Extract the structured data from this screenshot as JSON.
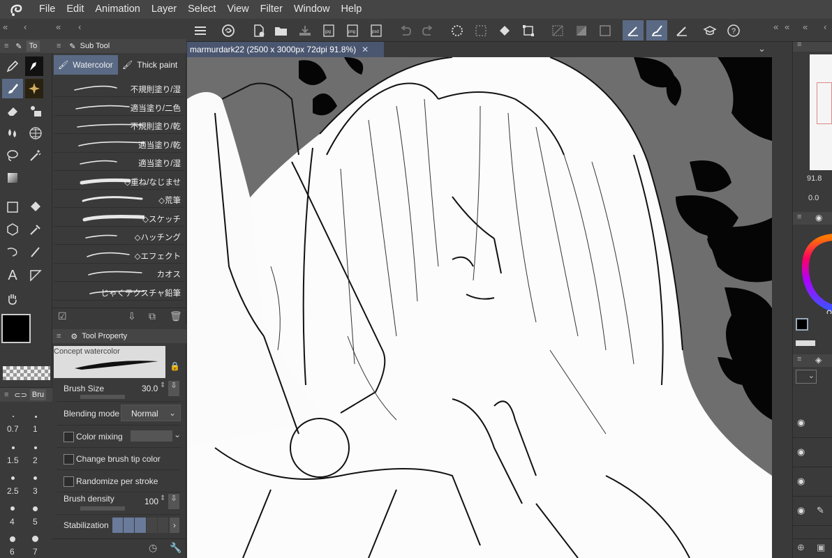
{
  "menu": [
    "File",
    "Edit",
    "Animation",
    "Layer",
    "Select",
    "View",
    "Filter",
    "Window",
    "Help"
  ],
  "left_panel": {
    "tool_tab_label": "To",
    "subtool_header": "Sub Tool",
    "subtool_tabs": [
      "Watercolor",
      "Thick paint"
    ],
    "brushes": [
      "不規則塗り/湿",
      "適当塗り/二色",
      "不規則塗り/乾",
      "適当塗り/乾",
      "適当塗り/湿",
      "◇重ね/なじませ",
      "◇荒筆",
      "◇スケッチ",
      "◇ハッチング",
      "◇エフェクト",
      "カオス",
      "じゃくテクスチャ鉛筆"
    ],
    "brush_size_tab": "Bru",
    "brush_size_values": [
      "0.7",
      "1",
      "1.5",
      "2",
      "2.5",
      "3",
      "4",
      "5",
      "6",
      "7"
    ]
  },
  "tool_property": {
    "header": "Tool Property",
    "preset_name": "Concept watercolor",
    "brush_size_label": "Brush Size",
    "brush_size_value": "30.0",
    "blending_mode_label": "Blending mode",
    "blending_mode_value": "Normal",
    "color_mixing_label": "Color mixing",
    "change_tip_label": "Change brush tip color",
    "randomize_label": "Randomize per stroke",
    "brush_density_label": "Brush density",
    "brush_density_value": "100",
    "stabilization_label": "Stabilization"
  },
  "document": {
    "tab_title": "marmurdark22 (2500 x 3000px 72dpi 91.8%)"
  },
  "right_panel": {
    "zoom_value": "91.8",
    "rotation_value": "0.0"
  },
  "colors": {
    "main_color": "#000000",
    "sub_color": "#5a2d34",
    "accent": "#5a6a85"
  }
}
